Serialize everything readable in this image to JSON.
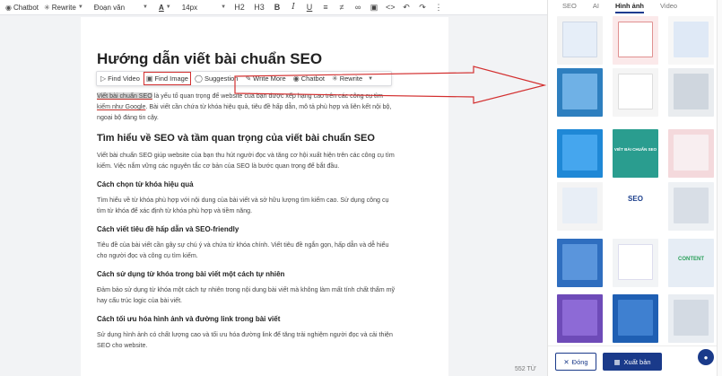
{
  "toolbar": {
    "chatbot_label": "Chatbot",
    "rewrite_label": "Rewrite",
    "paragraph_style": "Đoạn văn",
    "font_size": "14px",
    "h2_label": "H2",
    "h3_label": "H3"
  },
  "floating_toolbar": {
    "find_video": "Find Video",
    "find_image": "Find Image",
    "suggestion": "Suggestion",
    "write_more": "Write More",
    "chatbot": "Chatbot",
    "rewrite": "Rewrite"
  },
  "article": {
    "title": "Hướng dẫn viết bài chuẩn SEO",
    "intro_highlight": "Viết bài chuẩn SEO",
    "intro_rest_line1": " là yếu tố quan trọng để website của bạn được xếp hạng cao trên các công cụ tìm",
    "intro_line2_link": "kiếm như Google",
    "intro_line2_rest": ". Bài viết cần chứa từ khóa hiệu quả, tiêu đề hấp dẫn, mô tả phù hợp và liên kết nội bộ,",
    "intro_line3": "ngoại bộ đáng tin cậy.",
    "h2_1": "Tìm hiểu về SEO và tầm quan trọng của viết bài chuẩn SEO",
    "p2_line1": "Viết bài chuẩn SEO giúp website của bạn thu hút người đọc và tăng cơ hội xuất hiện trên các công cụ tìm",
    "p2_line2": "kiếm. Việc nắm vững các nguyên tắc cơ bản của SEO là bước quan trọng để bắt đầu.",
    "h3_1": "Cách chọn từ khóa hiệu quả",
    "p3_line1": "Tìm hiểu về từ khóa phù hợp với nội dung của bài viết và sở hữu lượng tìm kiếm cao. Sử dụng công cụ",
    "p3_line2": "tìm từ khóa để xác định từ khóa phù hợp và tiềm năng.",
    "h3_2": "Cách viết tiêu đề hấp dẫn và SEO-friendly",
    "p4_line1": "Tiêu đề của bài viết cần gây sự chú ý và chứa từ khóa chính. Viết tiêu đề ngắn gọn, hấp dẫn và dễ hiểu",
    "p4_line2": "cho người đọc và công cụ tìm kiếm.",
    "h3_3": "Cách sử dụng từ khóa trong bài viết một cách tự nhiên",
    "p5_line1": "Đảm bảo sử dụng từ khóa một cách tự nhiên trong nội dung bài viết mà không làm mất tính chất thẩm mỹ",
    "p5_line2": "hay cấu trúc logic của bài viết.",
    "h3_4": "Cách tối ưu hóa hình ảnh và đường link trong bài viết",
    "p6_line1": "Sử dụng hình ảnh có chất lượng cao và tối ưu hóa đường link để tăng trải nghiệm người đọc và cải thiện",
    "p6_line2": "SEO cho website."
  },
  "word_count": "552 TỪ",
  "panel": {
    "tabs": [
      "SEO",
      "AI",
      "Hình ảnh",
      "Video"
    ],
    "active_tab": "Hình ảnh",
    "close_button": "Đóng",
    "export_button": "Xuất bản",
    "tile_captions": {
      "viet_bai_chuan_seo": "VIẾT BÀI CHUẨN SEO",
      "seo": "SEO",
      "content": "CONTENT"
    }
  },
  "colors": {
    "accent": "#1a3a8a",
    "highlight_border": "#d32f2f",
    "arrow": "#d32f2f"
  }
}
